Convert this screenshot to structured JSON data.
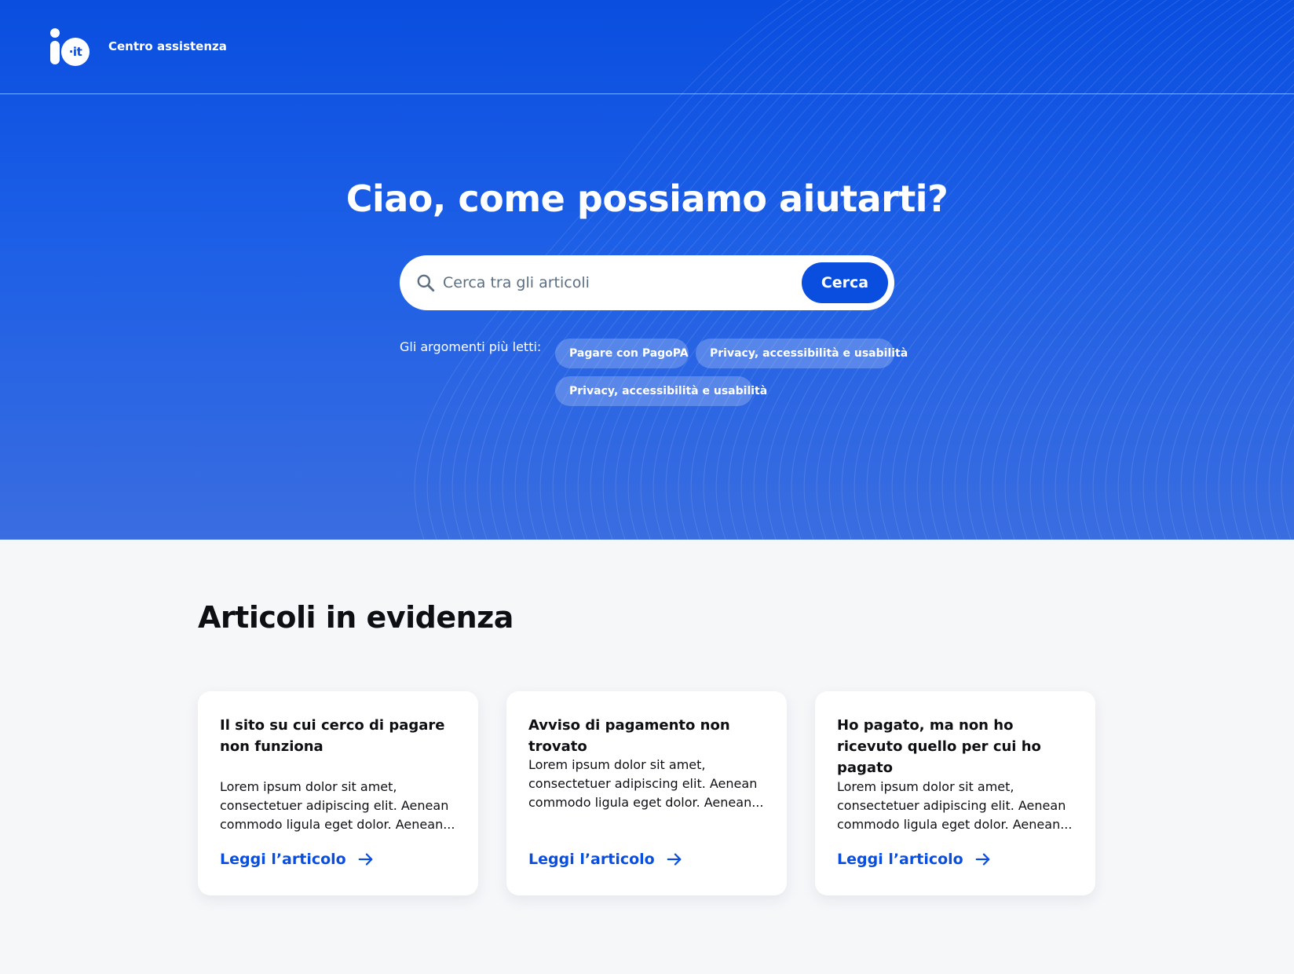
{
  "header": {
    "logo_text": "·it",
    "title": "Centro assistenza"
  },
  "hero": {
    "title": "Ciao, come possiamo aiutarti?",
    "search": {
      "placeholder": "Cerca tra gli articoli",
      "value": "",
      "button_label": "Cerca",
      "icon": "search-icon"
    },
    "topics_label": "Gli argomenti più letti:",
    "topics": [
      "Pagare con PagoPA",
      "Privacy, accessibilità e usabilità",
      "Privacy, accessibilità e usabilità"
    ]
  },
  "featured": {
    "title": "Articoli in evidenza",
    "cards": [
      {
        "title": "Il sito su cui cerco di pagare non funziona",
        "body": "Lorem ipsum dolor sit amet, consectetuer adipiscing elit. Aenean commodo ligula eget dolor. Aenean...",
        "link_label": "Leggi l’articolo"
      },
      {
        "title": "Avviso di pagamento non trovato",
        "body": "Lorem ipsum dolor sit amet, consectetuer adipiscing elit. Aenean commodo ligula eget dolor. Aenean...",
        "link_label": "Leggi l’articolo"
      },
      {
        "title": "Ho pagato, ma non ho ricevuto quello per cui ho pagato",
        "body": "Lorem ipsum dolor sit amet, consectetuer adipiscing elit. Aenean commodo ligula eget dolor. Aenean...",
        "link_label": "Leggi l’articolo"
      }
    ]
  },
  "colors": {
    "brand_blue": "#0a4ee0",
    "page_background": "#f6f7f9",
    "card_background": "#ffffff",
    "text_dark": "#0e0f13"
  }
}
